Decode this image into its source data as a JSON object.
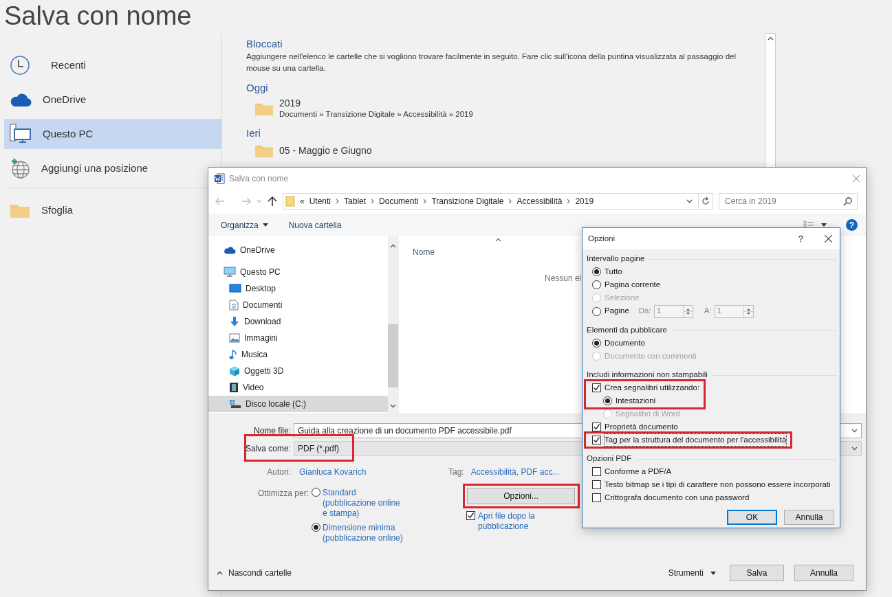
{
  "backstage": {
    "title": "Salva con nome",
    "places": [
      {
        "label": "Recenti",
        "selected": false
      },
      {
        "label": "OneDrive",
        "selected": false
      },
      {
        "label": "Questo PC",
        "selected": true
      },
      {
        "label": "Aggiungi una posizione",
        "selected": false
      }
    ],
    "browse": {
      "label": "Sfoglia"
    },
    "sections": [
      {
        "heading": "Bloccati",
        "description": "Aggiungere nell'elenco le cartelle che si vogliono trovare facilmente in seguito. Fare clic sull'icona della puntina visualizzata al passaggio del mouse su una cartella."
      },
      {
        "heading": "Oggi",
        "folders": [
          {
            "name": "2019",
            "path": "Documenti » Transizione Digitale » Accessibilità » 2019"
          }
        ]
      },
      {
        "heading": "Ieri",
        "folders": [
          {
            "name": "05 - Maggio e Giugno"
          }
        ]
      }
    ]
  },
  "save_dialog": {
    "title": "Salva con nome",
    "breadcrumb_overflow": "«",
    "breadcrumb": [
      "Utenti",
      "Tablet",
      "Documenti",
      "Transizione Digitale",
      "Accessibilità",
      "2019"
    ],
    "search": {
      "placeholder": "Cerca in 2019"
    },
    "toolbar": [
      "Organizza",
      "Nuova cartella"
    ],
    "help": "?",
    "tree": [
      {
        "label": "OneDrive",
        "selected": false
      },
      {
        "label": "Questo PC",
        "selected": false,
        "children": [
          {
            "label": "Desktop",
            "selected": false
          },
          {
            "label": "Documenti",
            "selected": false
          },
          {
            "label": "Download",
            "selected": false
          },
          {
            "label": "Immagini",
            "selected": false
          },
          {
            "label": "Musica",
            "selected": false
          },
          {
            "label": "Oggetti 3D",
            "selected": false
          },
          {
            "label": "Video",
            "selected": false
          },
          {
            "label": "Disco locale (C:)",
            "selected": true
          }
        ]
      }
    ],
    "columns": [
      "Nome"
    ],
    "empty_message": "Nessun el",
    "file_name": {
      "label": "Nome file:",
      "value": "Guida alla creazione di un documento PDF accessibile.pdf"
    },
    "save_as": {
      "label": "Salva come:",
      "value": "PDF (*.pdf)",
      "highlighted": true
    },
    "meta": [
      {
        "label": "Autori:",
        "value": "Gianluca Kovarich"
      },
      {
        "label": "Tag:",
        "value": "Accessibilità, PDF acc..."
      }
    ],
    "optimize": {
      "label": "Ottimizza per:",
      "options": [
        {
          "label": "Standard (pubblicazione online e stampa)",
          "selected": false
        },
        {
          "label": "Dimensione minima (pubblicazione online)",
          "selected": true
        }
      ]
    },
    "options_button": {
      "label": "Opzioni...",
      "highlighted": true
    },
    "open_after": {
      "label": "Apri file dopo la pubblicazione",
      "checked": true
    },
    "hide_folders": "Nascondi cartelle",
    "tools": "Strumenti",
    "buttons": [
      "Salva",
      "Annulla"
    ]
  },
  "options_dialog": {
    "title": "Opzioni",
    "help": "?",
    "groups": [
      {
        "heading": "Intervallo pagine",
        "items": [
          {
            "kind": "radio",
            "label": "Tutto",
            "selected": true,
            "disabled": false,
            "highlighted": false,
            "focused": false
          },
          {
            "kind": "radio",
            "label": "Pagina corrente",
            "selected": false,
            "disabled": false,
            "highlighted": false,
            "focused": false
          },
          {
            "kind": "radio",
            "label": "Selezione",
            "selected": false,
            "disabled": true,
            "highlighted": false,
            "focused": false
          },
          {
            "kind": "range",
            "label": "Pagine",
            "selected": false,
            "disabled": false,
            "highlighted": false,
            "focused": false,
            "from_label": "Da:",
            "from": "1",
            "to_label": "A:",
            "to": "1"
          }
        ]
      },
      {
        "heading": "Elementi da pubblicare",
        "items": [
          {
            "kind": "radio",
            "label": "Documento",
            "selected": true,
            "disabled": false,
            "highlighted": false,
            "focused": false
          },
          {
            "kind": "radio",
            "label": "Documento con commenti",
            "selected": false,
            "disabled": true,
            "highlighted": false,
            "focused": false
          }
        ]
      },
      {
        "heading": "Includi informazioni non stampabili",
        "items": [
          {
            "kind": "checkbox",
            "label": "Crea segnalibri utilizzando:",
            "checked": true,
            "disabled": false,
            "highlighted": true,
            "focused": false,
            "children": [
              {
                "kind": "radio",
                "label": "Intestazioni",
                "selected": true,
                "disabled": false,
                "highlighted": true,
                "focused": false
              },
              {
                "kind": "radio",
                "label": "Segnalibri di Word",
                "selected": false,
                "disabled": true,
                "highlighted": false,
                "focused": false
              }
            ]
          },
          {
            "kind": "checkbox",
            "label": "Proprietà documento",
            "checked": true,
            "disabled": false,
            "highlighted": false,
            "focused": false
          },
          {
            "kind": "checkbox",
            "label": "Tag per la struttura del documento per l'accessibilità",
            "checked": true,
            "disabled": false,
            "highlighted": true,
            "focused": true
          }
        ]
      },
      {
        "heading": "Opzioni PDF",
        "items": [
          {
            "kind": "checkbox",
            "label": "Conforme a PDF/A",
            "checked": false,
            "disabled": false,
            "highlighted": false,
            "focused": false
          },
          {
            "kind": "checkbox",
            "label": "Testo bitmap se i tipi di carattere non possono essere incorporati",
            "checked": false,
            "disabled": false,
            "highlighted": false,
            "focused": false
          },
          {
            "kind": "checkbox",
            "label": "Crittografa documento con una password",
            "checked": false,
            "disabled": false,
            "highlighted": false,
            "focused": false
          }
        ]
      }
    ],
    "buttons": [
      {
        "label": "OK",
        "default": true
      },
      {
        "label": "Annulla",
        "default": false
      }
    ]
  }
}
